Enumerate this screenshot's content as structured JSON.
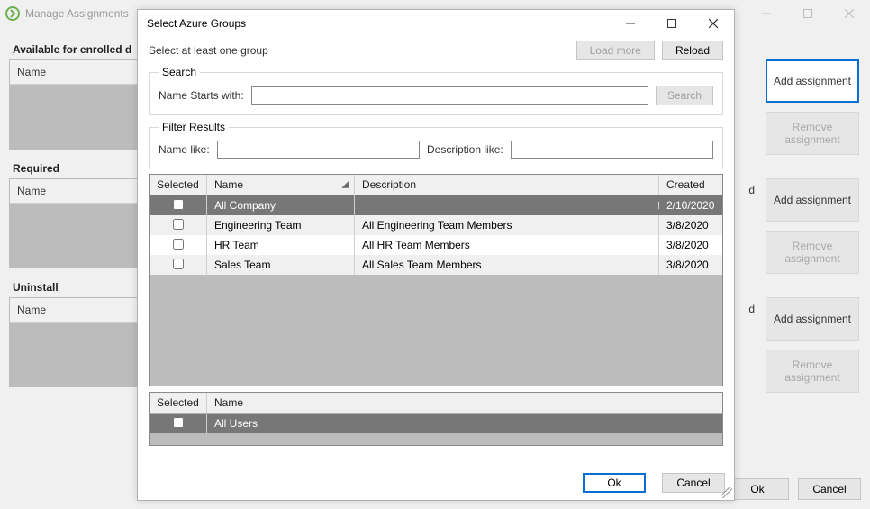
{
  "parent_window": {
    "title": "Manage Assignments",
    "sections": {
      "available": "Available for enrolled d",
      "required": "Required",
      "uninstall": "Uninstall"
    },
    "name_header": "Name",
    "buttons": {
      "add_assignment": "Add assignment",
      "remove_assignment": "Remove assignment",
      "ok": "Ok",
      "cancel": "Cancel"
    },
    "truncated_label": "d"
  },
  "modal": {
    "title": "Select Azure Groups",
    "instruction": "Select at least one group",
    "buttons": {
      "load_more": "Load more",
      "reload": "Reload",
      "search": "Search",
      "ok": "Ok",
      "cancel": "Cancel"
    },
    "search": {
      "legend": "Search",
      "starts_with_label": "Name Starts with:"
    },
    "filter": {
      "legend": "Filter Results",
      "name_like_label": "Name like:",
      "desc_like_label": "Description like:"
    },
    "grid": {
      "headers": {
        "selected": "Selected",
        "name": "Name",
        "description": "Description",
        "created": "Created"
      },
      "rows": [
        {
          "name": "All Company",
          "description": "",
          "created": "2/10/2020",
          "selected_row": true
        },
        {
          "name": "Engineering Team",
          "description": "All Engineering Team Members",
          "created": "3/8/2020"
        },
        {
          "name": "HR Team",
          "description": "All HR Team Members",
          "created": "3/8/2020"
        },
        {
          "name": "Sales Team",
          "description": "All Sales Team Members",
          "created": "3/8/2020"
        }
      ]
    },
    "bottom_grid": {
      "headers": {
        "selected": "Selected",
        "name": "Name"
      },
      "row": {
        "name": "All Users"
      }
    }
  }
}
